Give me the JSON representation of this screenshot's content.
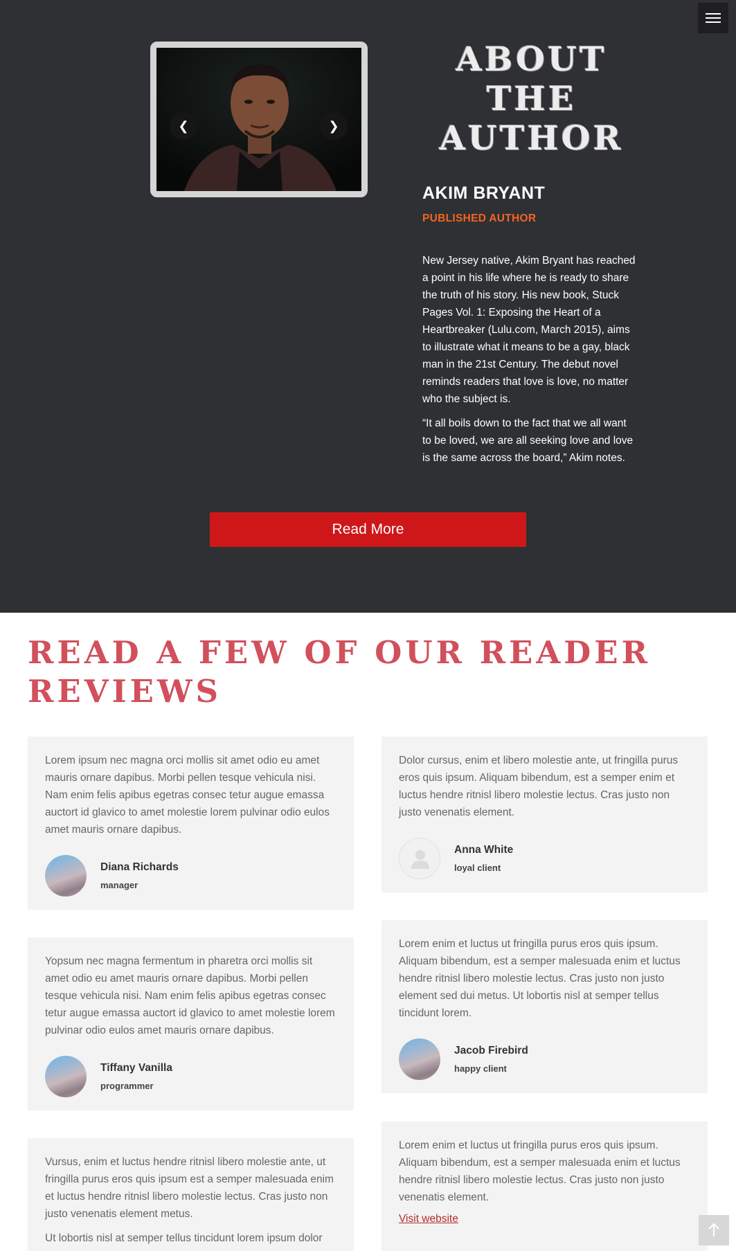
{
  "about": {
    "title": "ABOUT THE AUTHOR",
    "author_name": "AKIM BRYANT",
    "author_role": "PUBLISHED AUTHOR",
    "bio": [
      "New Jersey native, Akim Bryant has reached a point in his life where he is ready to share the truth of his story. His new book, Stuck Pages Vol. 1: Exposing the Heart of a Heartbreaker (Lulu.com, March 2015), aims to illustrate what it means to be a gay, black man in the 21st Century. The debut novel reminds readers that love is love, no matter who the subject is.",
      "“It all boils down to the fact that we all want to be loved, we are all seeking love and love is the same across the board,” Akim notes."
    ],
    "read_more": "Read More",
    "slider": {
      "prev_icon": "chevron-left-icon",
      "next_icon": "chevron-right-icon"
    }
  },
  "menu": {
    "icon": "hamburger-menu-icon"
  },
  "reviews": {
    "title": "READ A FEW OF OUR READER REVIEWS",
    "left": [
      {
        "text": [
          "Lorem ipsum nec magna orci mollis sit amet odio eu amet mauris ornare dapibus. Morbi pellen tesque vehicula nisi. Nam enim felis apibus egetras consec tetur augue emassa auctort id glavico to amet molestie lorem pulvinar odio eulos amet mauris ornare dapibus."
        ],
        "name": "Diana Richards",
        "role": "manager"
      },
      {
        "text": [
          "Yopsum nec magna fermentum in pharetra orci mollis sit amet odio eu amet mauris ornare dapibus. Morbi pellen tesque vehicula nisi. Nam enim felis apibus egetras consec tetur augue emassa auctort id glavico to amet molestie lorem pulvinar odio eulos amet mauris ornare dapibus."
        ],
        "name": "Tiffany Vanilla",
        "role": "programmer"
      },
      {
        "text": [
          "Vursus, enim et luctus hendre ritnisl libero molestie ante, ut fringilla purus eros quis ipsum est a semper malesuada enim et luctus hendre ritnisl libero molestie lectus. Cras justo non justo venenatis element metus.",
          "Ut lobortis nisl at semper tellus tincidunt lorem ipsum dolor"
        ]
      }
    ],
    "right": [
      {
        "text": [
          "Dolor cursus, enim et libero molestie ante, ut fringilla purus eros quis ipsum. Aliquam bibendum, est a semper enim et luctus hendre ritnisl libero molestie lectus. Cras justo non justo venenatis element."
        ],
        "name": "Anna White",
        "role": "loyal client"
      },
      {
        "text": [
          "Lorem enim et luctus ut fringilla purus eros quis ipsum. Aliquam bibendum, est a semper malesuada enim et luctus hendre ritnisl libero molestie lectus. Cras justo non justo element sed dui metus. Ut lobortis nisl at semper tellus tincidunt lorem."
        ],
        "name": "Jacob Firebird",
        "role": "happy client"
      },
      {
        "text": [
          "Lorem enim et luctus ut fringilla purus eros quis ipsum. Aliquam bibendum, est a semper malesuada enim et luctus hendre ritnisl libero molestie lectus. Cras justo non justo venenatis element."
        ],
        "link": "Visit website"
      }
    ]
  },
  "back_to_top": {
    "icon": "arrow-up-icon"
  },
  "colors": {
    "dark_bg": "#2f3033",
    "accent_orange": "#f26522",
    "button_red": "#cf171a",
    "reviews_title": "#c93240",
    "card_bg": "#f3f3f3"
  }
}
